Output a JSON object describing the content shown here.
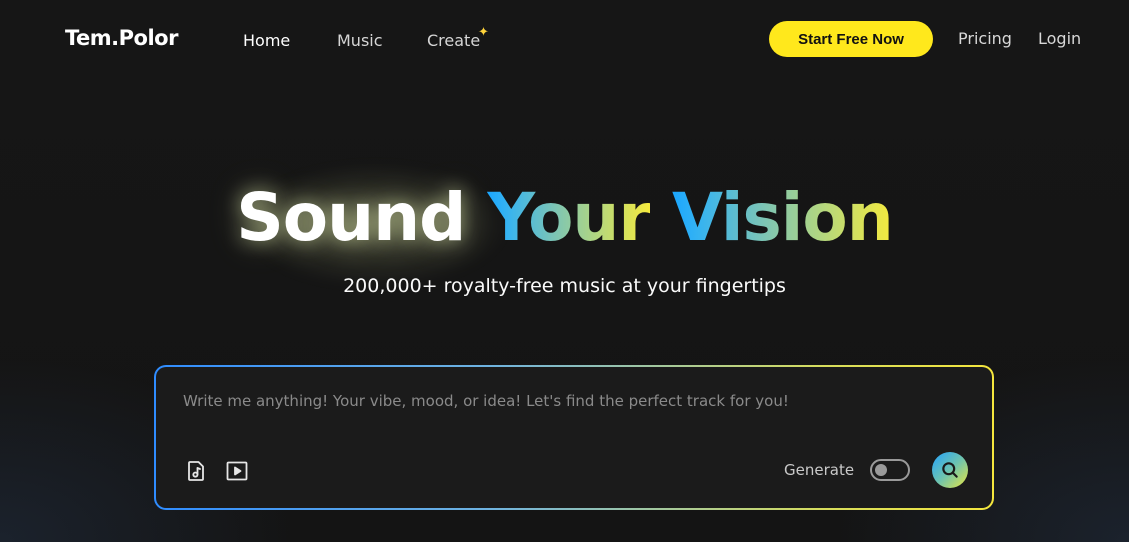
{
  "header": {
    "logo": "Tem.Polor",
    "nav": {
      "home": "Home",
      "music": "Music",
      "create": "Create"
    },
    "cta": "Start Free Now",
    "pricing": "Pricing",
    "login": "Login"
  },
  "hero": {
    "title_word_1": "Sound",
    "title_word_2": "Your",
    "title_word_3": "Vision",
    "subtitle": "200,000+ royalty-free music at your fingertips"
  },
  "prompt": {
    "placeholder": "Write me anything! Your vibe, mood, or idea! Let's find the perfect track for you!",
    "value": "",
    "generate_label": "Generate",
    "generate_enabled": false,
    "icons": [
      "music-note-icon",
      "video-play-icon",
      "search-icon",
      "sparkle-icon"
    ]
  },
  "colors": {
    "background": "#151515",
    "cta": "#ffe81c",
    "gradient_start": "#1aa6ff",
    "gradient_end": "#f5ea3d"
  }
}
